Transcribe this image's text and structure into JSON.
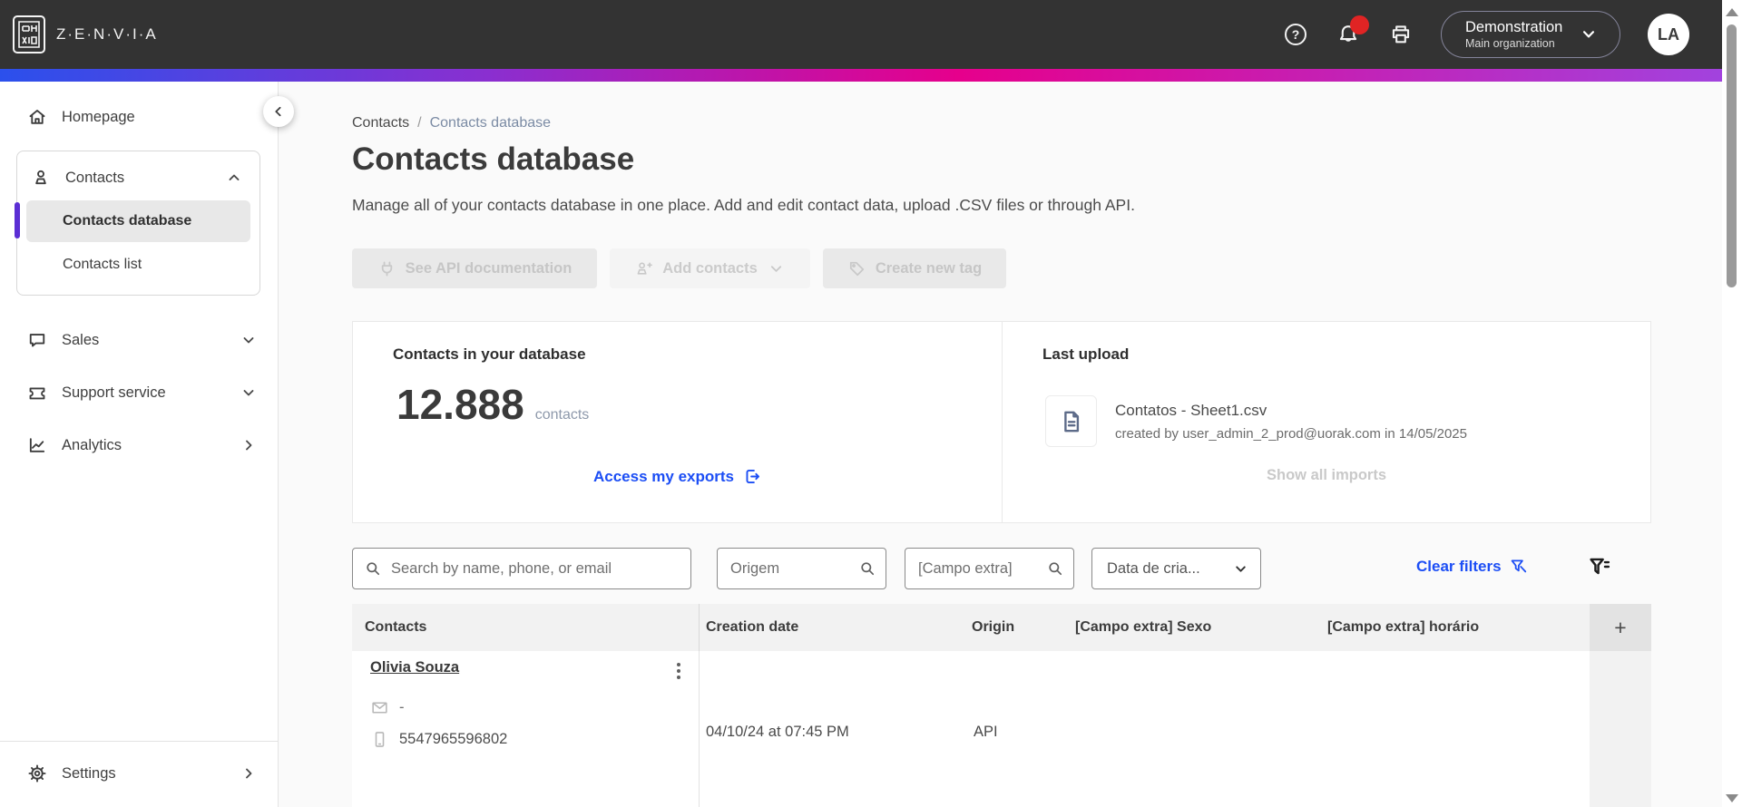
{
  "colors": {
    "topbar_bg": "#333333",
    "gradient_from": "#2b50ec",
    "gradient_mid": "#e6008c",
    "gradient_to": "#a044e0",
    "accent_blue": "#1c4ef5",
    "active_indicator": "#5b2ed4",
    "notification_red": "#e02424"
  },
  "topbar": {
    "brand": "Z·E·N·V·I·A",
    "help_glyph": "?",
    "org": {
      "name": "Demonstration",
      "subtitle": "Main organization"
    },
    "avatar": "LA"
  },
  "sidebar": {
    "homepage": "Homepage",
    "contacts": {
      "label": "Contacts",
      "items": [
        {
          "label": "Contacts database"
        },
        {
          "label": "Contacts list"
        }
      ]
    },
    "sales": "Sales",
    "support": "Support service",
    "analytics": "Analytics",
    "settings": "Settings"
  },
  "breadcrumb": {
    "root": "Contacts",
    "separator": "/",
    "current": "Contacts database"
  },
  "page": {
    "title": "Contacts database",
    "subtitle": "Manage all of your contacts database in one place. Add and edit contact data, upload .CSV files or through API."
  },
  "actions": {
    "api_docs": "See API documentation",
    "add_contacts": "Add contacts",
    "create_tag": "Create new tag"
  },
  "stats": {
    "title": "Contacts in your database",
    "count": "12.888",
    "unit": "contacts",
    "exports_link": "Access my exports"
  },
  "last_upload": {
    "title": "Last upload",
    "file": "Contatos - Sheet1.csv",
    "meta": "created by user_admin_2_prod@uorak.com in 14/05/2025",
    "show_all": "Show all imports"
  },
  "filters": {
    "search_placeholder": "Search by name, phone, or email",
    "origin_placeholder": "Origem",
    "extra_placeholder": "[Campo extra]",
    "date_label": "Data de cria...",
    "clear_label": "Clear filters"
  },
  "table": {
    "columns": [
      "Contacts",
      "Creation date",
      "Origin",
      "[Campo extra] Sexo",
      "[Campo extra] horário"
    ],
    "add_column_label": "+",
    "rows": [
      {
        "name": "Olivia Souza",
        "email": "-",
        "phone": "5547965596802",
        "created": "04/10/24 at 07:45 PM",
        "origin": "API"
      }
    ]
  }
}
